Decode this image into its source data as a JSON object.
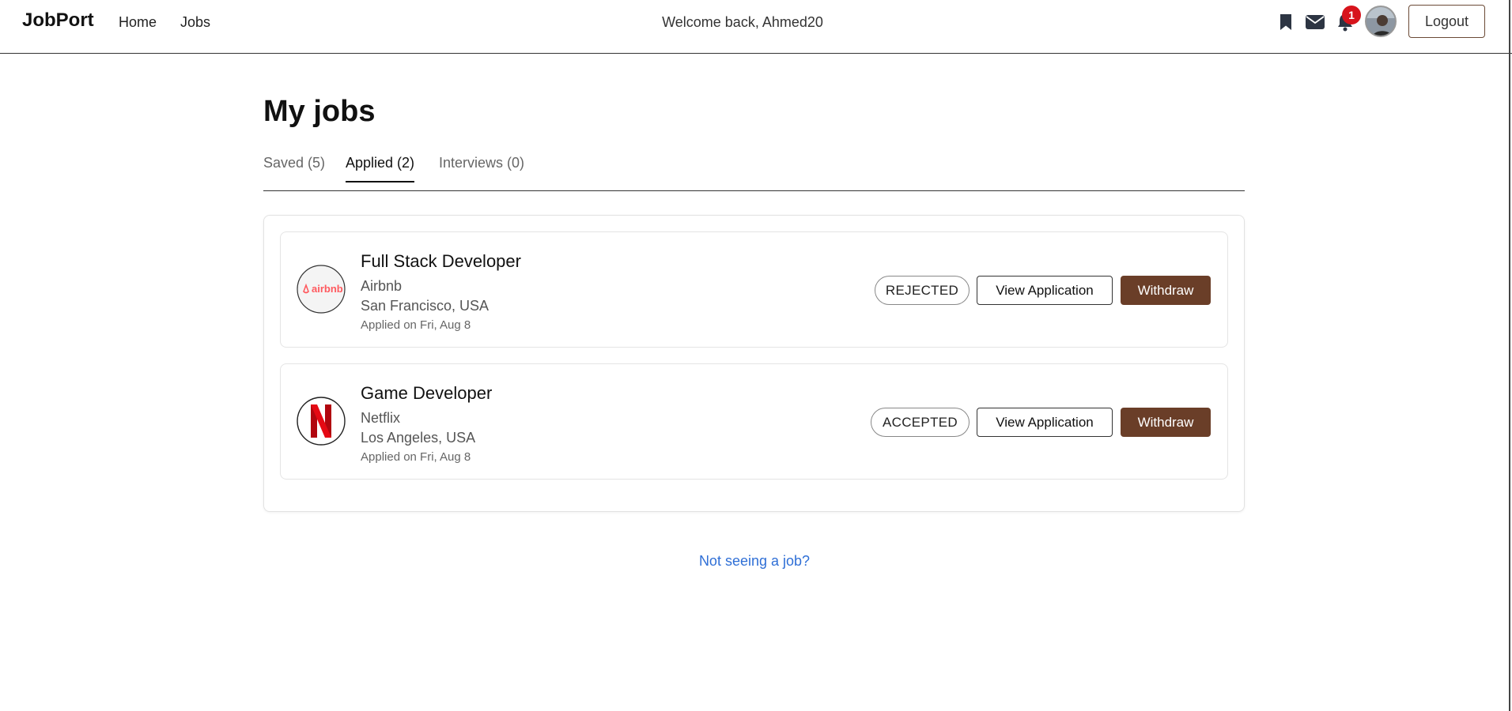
{
  "header": {
    "brand": "JobPort",
    "nav": [
      {
        "label": "Home"
      },
      {
        "label": "Jobs"
      }
    ],
    "welcome": "Welcome back, Ahmed20",
    "icons": [
      "bookmark-icon",
      "mail-icon",
      "bell-icon"
    ],
    "notification_count": "1",
    "logout_label": "Logout"
  },
  "page": {
    "title": "My jobs",
    "tabs": [
      {
        "label": "Saved (5)",
        "active": false
      },
      {
        "label": "Applied (2)",
        "active": true
      },
      {
        "label": "Interviews (0)",
        "active": false
      }
    ]
  },
  "jobs": [
    {
      "title": "Full Stack Developer",
      "company": "Airbnb",
      "logo_text": "airbnb",
      "location": "San Francisco, USA",
      "applied": "Applied on Fri, Aug 8",
      "status": "REJECTED",
      "view_label": "View Application",
      "withdraw_label": "Withdraw"
    },
    {
      "title": "Game Developer",
      "company": "Netflix",
      "logo_text": "N",
      "location": "Los Angeles, USA",
      "applied": "Applied on Fri, Aug 8",
      "status": "ACCEPTED",
      "view_label": "View Application",
      "withdraw_label": "Withdraw"
    }
  ],
  "footer_link": "Not seeing a job?",
  "colors": {
    "accent": "#6a3e28",
    "badge": "#d7141c",
    "link": "#2f6fd6",
    "airbnb": "#ff5a5f",
    "netflix": "#e50914"
  }
}
